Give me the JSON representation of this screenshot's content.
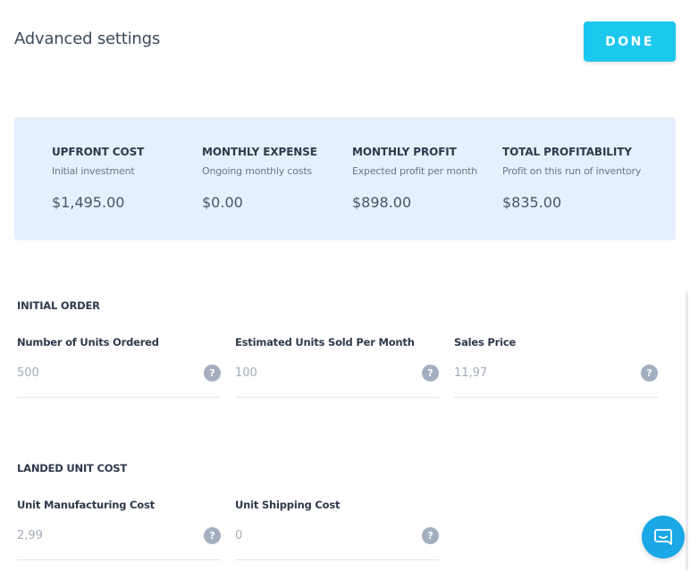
{
  "header": {
    "title": "Advanced settings",
    "done_label": "DONE"
  },
  "summary": {
    "metrics": [
      {
        "title": "UPFRONT COST",
        "subtitle": "Initial investment",
        "value": "$1,495.00"
      },
      {
        "title": "MONTHLY EXPENSE",
        "subtitle": "Ongoing monthly costs",
        "value": "$0.00"
      },
      {
        "title": "MONTHLY PROFIT",
        "subtitle": "Expected profit per month",
        "value": "$898.00"
      },
      {
        "title": "TOTAL PROFITABILITY",
        "subtitle": "Profit on this run of inventory",
        "value": "$835.00"
      }
    ]
  },
  "initial_order": {
    "title": "INITIAL ORDER",
    "fields": [
      {
        "label": "Number of Units Ordered",
        "value": "500"
      },
      {
        "label": "Estimated Units Sold Per Month",
        "value": "100"
      },
      {
        "label": "Sales Price",
        "value": "11,97"
      }
    ]
  },
  "landed_unit_cost": {
    "title": "LANDED UNIT COST",
    "fields": [
      {
        "label": "Unit Manufacturing Cost",
        "value": "2,99"
      },
      {
        "label": "Unit Shipping Cost",
        "value": "0"
      }
    ]
  },
  "help_glyph": "?",
  "icons": {
    "help": "question-circle-icon",
    "chat": "chat-bubble-icon"
  },
  "colors": {
    "accent": "#1cc8ee",
    "card_bg": "#e5f0fd",
    "help_icon": "#a3afbf",
    "chat": "#1aa8e6"
  }
}
